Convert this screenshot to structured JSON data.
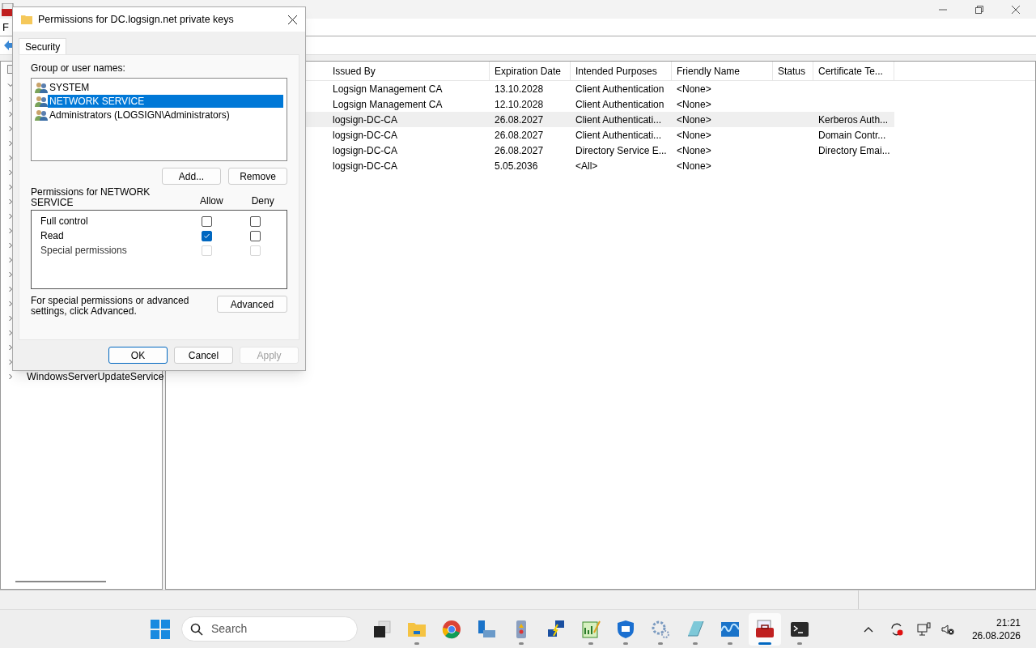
{
  "main_window": {
    "menu": [
      "F"
    ]
  },
  "tree": {
    "items": [
      {
        "expanded": true
      },
      {
        "expanded": false
      },
      {
        "expanded": false
      },
      {
        "expanded": false
      },
      {
        "expanded": false
      },
      {
        "expanded": false
      },
      {
        "expanded": false
      },
      {
        "expanded": false
      },
      {
        "expanded": false
      },
      {
        "expanded": false
      },
      {
        "expanded": false
      },
      {
        "expanded": false
      },
      {
        "expanded": false
      },
      {
        "expanded": false
      },
      {
        "expanded": false
      },
      {
        "expanded": false
      },
      {
        "expanded": false
      },
      {
        "expanded": false
      },
      {
        "expanded": false
      },
      {
        "expanded": false
      },
      {
        "expanded": false,
        "label": "WindowsServerUpdateService"
      }
    ]
  },
  "table": {
    "columns": [
      "Issued By",
      "Expiration Date",
      "Intended Purposes",
      "Friendly Name",
      "Status",
      "Certificate Te..."
    ],
    "rows": [
      {
        "selected": false,
        "cells": [
          "Logsign Management CA",
          "13.10.2028",
          "Client Authentication",
          "<None>",
          "",
          ""
        ]
      },
      {
        "selected": false,
        "cells": [
          "Logsign Management CA",
          "12.10.2028",
          "Client Authentication",
          "<None>",
          "",
          ""
        ]
      },
      {
        "selected": true,
        "cells": [
          "logsign-DC-CA",
          "26.08.2027",
          "Client Authenticati...",
          "<None>",
          "",
          "Kerberos Auth..."
        ]
      },
      {
        "selected": false,
        "cells": [
          "logsign-DC-CA",
          "26.08.2027",
          "Client Authenticati...",
          "<None>",
          "",
          "Domain Contr..."
        ]
      },
      {
        "selected": false,
        "cells": [
          "logsign-DC-CA",
          "26.08.2027",
          "Directory Service E...",
          "<None>",
          "",
          "Directory Emai..."
        ]
      },
      {
        "selected": false,
        "cells": [
          "logsign-DC-CA",
          "5.05.2036",
          "<All>",
          "<None>",
          "",
          ""
        ]
      }
    ]
  },
  "dialog": {
    "title": "Permissions for DC.logsign.net private keys",
    "tabs": [
      {
        "label": "Security",
        "selected": true
      }
    ],
    "group_label": "Group or user names:",
    "users": [
      {
        "name": "SYSTEM",
        "selected": false
      },
      {
        "name": "NETWORK SERVICE",
        "selected": true
      },
      {
        "name": "Administrators (LOGSIGN\\Administrators)",
        "selected": false
      }
    ],
    "add_button": "Add...",
    "remove_button": "Remove",
    "permissions_label": "Permissions for NETWORK SERVICE",
    "allow_label": "Allow",
    "deny_label": "Deny",
    "permissions": [
      {
        "name": "Full control",
        "allow": false,
        "deny": false,
        "disabled": false
      },
      {
        "name": "Read",
        "allow": true,
        "deny": false,
        "disabled": false
      },
      {
        "name": "Special permissions",
        "allow": false,
        "deny": false,
        "disabled": true
      }
    ],
    "advanced_text": "For special permissions or advanced settings, click Advanced.",
    "advanced_button": "Advanced",
    "buttons": [
      {
        "label": "OK",
        "kind": "default",
        "disabled": false
      },
      {
        "label": "Cancel",
        "kind": "normal",
        "disabled": false
      },
      {
        "label": "Apply",
        "kind": "normal",
        "disabled": true
      }
    ]
  },
  "taskbar": {
    "search_placeholder": "Search",
    "apps": [
      {
        "kind": "taskview",
        "running": false,
        "selected": false
      },
      {
        "kind": "folder",
        "running": true,
        "selected": false
      },
      {
        "kind": "browser",
        "running": false,
        "selected": false
      },
      {
        "kind": "server",
        "running": false,
        "selected": false
      },
      {
        "kind": "log",
        "running": true,
        "selected": false
      },
      {
        "kind": "network",
        "running": false,
        "selected": false
      },
      {
        "kind": "editor",
        "running": true,
        "selected": false
      },
      {
        "kind": "shield",
        "running": true,
        "selected": false
      },
      {
        "kind": "gears",
        "running": true,
        "selected": false
      },
      {
        "kind": "notepad",
        "running": true,
        "selected": false
      },
      {
        "kind": "monitor",
        "running": true,
        "selected": false
      },
      {
        "kind": "toolbox",
        "running": true,
        "selected": true
      },
      {
        "kind": "terminal",
        "running": true,
        "selected": false
      }
    ],
    "time": "21:21",
    "date": "26.08.2026"
  }
}
